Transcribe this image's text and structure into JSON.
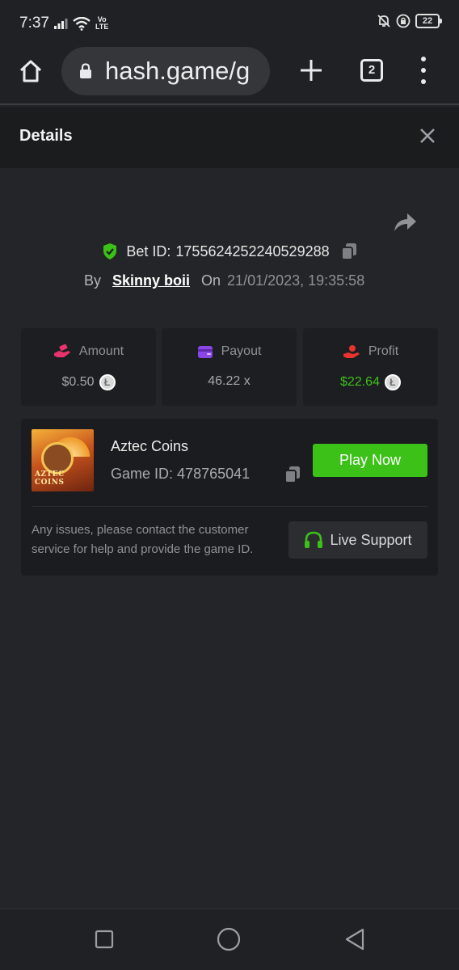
{
  "status": {
    "time": "7:37",
    "volte_top": "Vo",
    "volte_bottom": "LTE",
    "battery": "22"
  },
  "browser": {
    "url": "hash.game/g",
    "tab_count": "2"
  },
  "details": {
    "title": "Details"
  },
  "bet": {
    "id_label": "Bet ID:",
    "id": "1755624252240529288",
    "by_label": "By",
    "user": "Skinny boii",
    "on_label": "On",
    "date": "21/01/2023, 19:35:58"
  },
  "stats": [
    {
      "label": "Amount",
      "value": "$0.50",
      "icon": "hand-money-icon",
      "value_color": "#a4a6aa"
    },
    {
      "label": "Payout",
      "value": "46.22 x",
      "icon": "wallet-icon",
      "value_color": "#a4a6aa"
    },
    {
      "label": "Profit",
      "value": "$22.64",
      "icon": "profit-hand-icon",
      "value_color": "#3bc117"
    }
  ],
  "coin_symbol": "Ł",
  "game": {
    "name": "Aztec Coins",
    "id_label": "Game ID:",
    "id": "478765041",
    "thumb_text": "AZTEC COINS",
    "play_label": "Play Now",
    "support_text": "Any issues, please contact the customer service for help and provide the game ID.",
    "support_label": "Live Support"
  },
  "colors": {
    "accent_green": "#3bc117",
    "background": "#242528",
    "card": "#1d1e21"
  }
}
